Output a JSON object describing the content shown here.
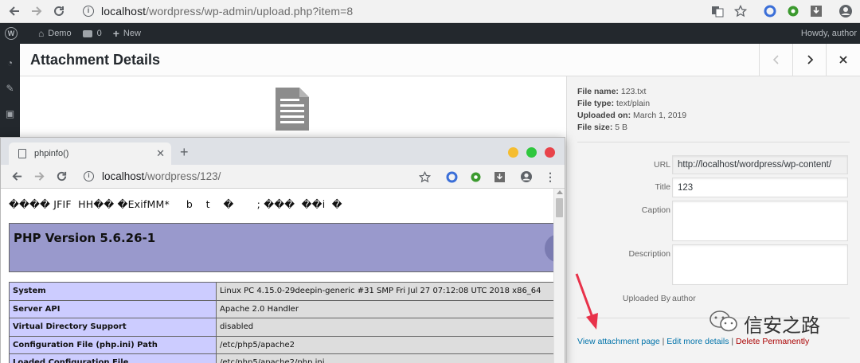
{
  "outer_browser": {
    "url_host": "localhost",
    "url_rest": "/wordpress/wp-admin/upload.php?item=8"
  },
  "admin_bar": {
    "site_name": "Demo",
    "comments_count": "0",
    "new_label": "New",
    "howdy": "Howdy, author"
  },
  "modal": {
    "title": "Attachment Details"
  },
  "file_info": {
    "name_label": "File name:",
    "name": "123.txt",
    "type_label": "File type:",
    "type": "text/plain",
    "uploaded_label": "Uploaded on:",
    "uploaded": "March 1, 2019",
    "size_label": "File size:",
    "size": "5 B"
  },
  "fields": {
    "url_label": "URL",
    "url_value": "http://localhost/wordpress/wp-content/",
    "title_label": "Title",
    "title_value": "123",
    "caption_label": "Caption",
    "caption_value": "",
    "description_label": "Description",
    "description_value": "",
    "uploaded_by_label": "Uploaded By",
    "uploaded_by_value": "author"
  },
  "actions": {
    "view_label": "View attachment page",
    "sep1": " | ",
    "edit_label": "Edit more details",
    "sep2": " | ",
    "delete_label": "Delete Permanently"
  },
  "inner_browser": {
    "tab_title": "phpinfo()",
    "url_host": "localhost",
    "url_rest": "/wordpress/123/",
    "garbage_line": "���� JFIF  HH�� �ExifMM*     b    t    �       ; ���  ��i  �",
    "php_version": "PHP Version 5.6.26-1",
    "rows": [
      {
        "key": "System",
        "value": "Linux PC 4.15.0-29deepin-generic #31 SMP Fri Jul 27 07:12:08 UTC 2018 x86_64"
      },
      {
        "key": "Server API",
        "value": "Apache 2.0 Handler"
      },
      {
        "key": "Virtual Directory Support",
        "value": "disabled"
      },
      {
        "key": "Configuration File (php.ini) Path",
        "value": "/etc/php5/apache2"
      },
      {
        "key": "Loaded Configuration File",
        "value": "/etc/php5/apache2/php.ini"
      }
    ]
  },
  "watermark": {
    "text": "信安之路"
  },
  "colors": {
    "wp_dark": "#23282d",
    "php_purple": "#9999cc",
    "php_key": "#ccccff",
    "php_value": "#dddddd",
    "link_blue": "#0073aa",
    "delete_red": "#a00000",
    "arrow_red": "#e8324a",
    "mac_yellow": "#f5bd30",
    "mac_green": "#2fc73e",
    "mac_red": "#e8434a"
  }
}
